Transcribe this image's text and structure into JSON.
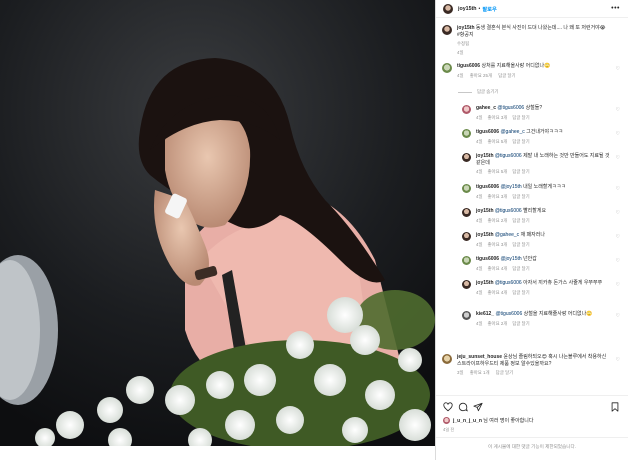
{
  "post": {
    "username": "joy15th",
    "follow_label": "팔로우",
    "more_icon": "more-horizontal-icon",
    "caption_user": "joy15th",
    "caption_text": "동생 결혼식 본식 사진이 드뎌 나왔는데.... 나 왜 또 저런거야😭 #항공지",
    "caption_edited": "수정됨",
    "caption_time": "4일"
  },
  "comments": [
    {
      "user": "tigus6006",
      "text": "상처를 지료해올사랑 어디없나🙄",
      "time": "4일",
      "likes": "좋아요 25개",
      "reply": "답글 달기",
      "view_replies": "답글 숨기기",
      "replies": [
        {
          "user": "gahee_c",
          "mention": "@tigus6006",
          "text": "상철들?",
          "time": "4일",
          "likes": "좋아요 3개",
          "reply": "답글 달기"
        },
        {
          "user": "tigus6006",
          "mention": "@gahee_c",
          "text": "그건내거야ㅋㅋㅋ",
          "time": "4일",
          "likes": "좋아요 5개",
          "reply": "답글 달기"
        },
        {
          "user": "joy15th",
          "mention": "@tigus6006",
          "text": "제발 내 노래하는 것만 만들어도 지료될 것 같은데",
          "time": "4일",
          "likes": "좋아요 5개",
          "reply": "답글 달기"
        },
        {
          "user": "tigus6006",
          "mention": "@joy15th",
          "text": "내일 노래할게ㅋㅋㅋ",
          "time": "4일",
          "likes": "좋아요 3개",
          "reply": "답글 달기"
        },
        {
          "user": "joy15th",
          "mention": "@tigus6006",
          "text": "빨리할게요",
          "time": "4일",
          "likes": "좋아요 2개",
          "reply": "답글 달기"
        },
        {
          "user": "joy15th",
          "mention": "@gahee_c",
          "text": "재 패자러나",
          "time": "4일",
          "likes": "좋아요 3개",
          "reply": "답글 달기"
        },
        {
          "user": "tigus6006",
          "mention": "@joy15th",
          "text": "넌안갑",
          "time": "4일",
          "likes": "좋아요 4개",
          "reply": "답글 달기"
        },
        {
          "user": "joy15th",
          "mention": "@tigus6006",
          "text": "아자서 끼카츄 돈가스 사줄게 우쭈쭈쭈",
          "time": "4일",
          "likes": "좋아요 4개",
          "reply": "답글 달기"
        },
        {
          "user": "kie612_",
          "mention": "@tigus6006",
          "text": "상철을 지료해줄사랑 어디없나🙄",
          "time": "4일",
          "likes": "좋아요 2개",
          "reply": "답글 달기"
        }
      ]
    },
    {
      "user": "jeju_sunset_house",
      "text": "윤상님 졸림하되오😍 혹시 나는블루에서 착용하신 스트라이프하우드티 제품 정보 알수있을까요?",
      "time": "3일",
      "likes": "좋아요 1개",
      "reply": "답글 달기"
    }
  ],
  "actions": {
    "like_icon": "heart-icon",
    "comment_icon": "comment-icon",
    "share_icon": "share-icon",
    "save_icon": "bookmark-icon",
    "likes_user": "j_u_n_j_u_n",
    "likes_text": "님 여러 명이 좋아합니다",
    "time_ago": "4일 전",
    "add_comment": "이 게시물에 대한 댓글 기능이 제한되었습니다."
  },
  "colors": {
    "accent": "#0095f6",
    "text": "#262626",
    "muted": "#8e8e8e",
    "link": "#00376b"
  }
}
